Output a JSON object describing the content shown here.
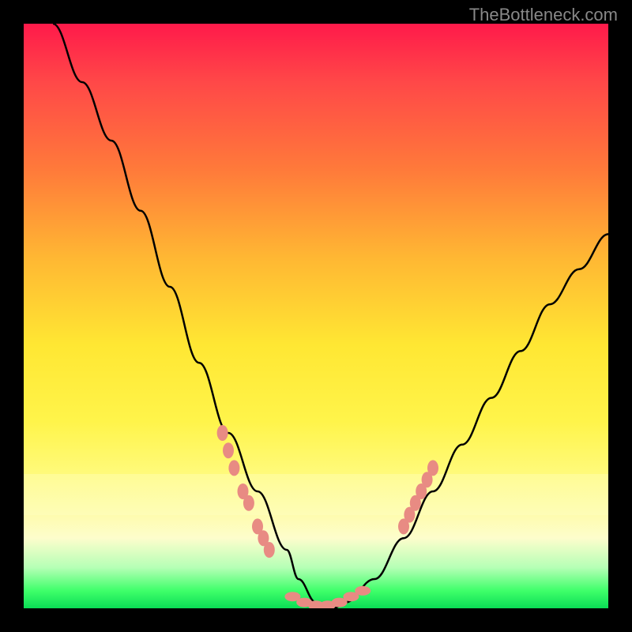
{
  "watermark": "TheBottleneck.com",
  "chart_data": {
    "type": "line",
    "title": "",
    "xlabel": "",
    "ylabel": "",
    "xlim": [
      0,
      100
    ],
    "ylim": [
      0,
      100
    ],
    "series": [
      {
        "name": "curve",
        "x": [
          5,
          10,
          15,
          20,
          25,
          30,
          35,
          40,
          45,
          47,
          50,
          53,
          55,
          60,
          65,
          70,
          75,
          80,
          85,
          90,
          95,
          100
        ],
        "y": [
          100,
          90,
          80,
          68,
          55,
          42,
          30,
          20,
          10,
          5,
          1,
          0,
          1,
          5,
          12,
          20,
          28,
          36,
          44,
          52,
          58,
          64
        ]
      }
    ],
    "markers_left": [
      {
        "x": 34,
        "y": 30
      },
      {
        "x": 35,
        "y": 27
      },
      {
        "x": 36,
        "y": 24
      },
      {
        "x": 37.5,
        "y": 20
      },
      {
        "x": 38.5,
        "y": 18
      },
      {
        "x": 40,
        "y": 14
      },
      {
        "x": 41,
        "y": 12
      },
      {
        "x": 42,
        "y": 10
      }
    ],
    "markers_bottom": [
      {
        "x": 46,
        "y": 2
      },
      {
        "x": 48,
        "y": 1
      },
      {
        "x": 50,
        "y": 0.5
      },
      {
        "x": 52,
        "y": 0.5
      },
      {
        "x": 54,
        "y": 1
      },
      {
        "x": 56,
        "y": 2
      },
      {
        "x": 58,
        "y": 3
      }
    ],
    "markers_right": [
      {
        "x": 65,
        "y": 14
      },
      {
        "x": 66,
        "y": 16
      },
      {
        "x": 67,
        "y": 18
      },
      {
        "x": 68,
        "y": 20
      },
      {
        "x": 69,
        "y": 22
      },
      {
        "x": 70,
        "y": 24
      }
    ],
    "background_gradient": {
      "top": "#ff1a4a",
      "mid": "#ffe733",
      "bottom": "#0add55"
    }
  }
}
